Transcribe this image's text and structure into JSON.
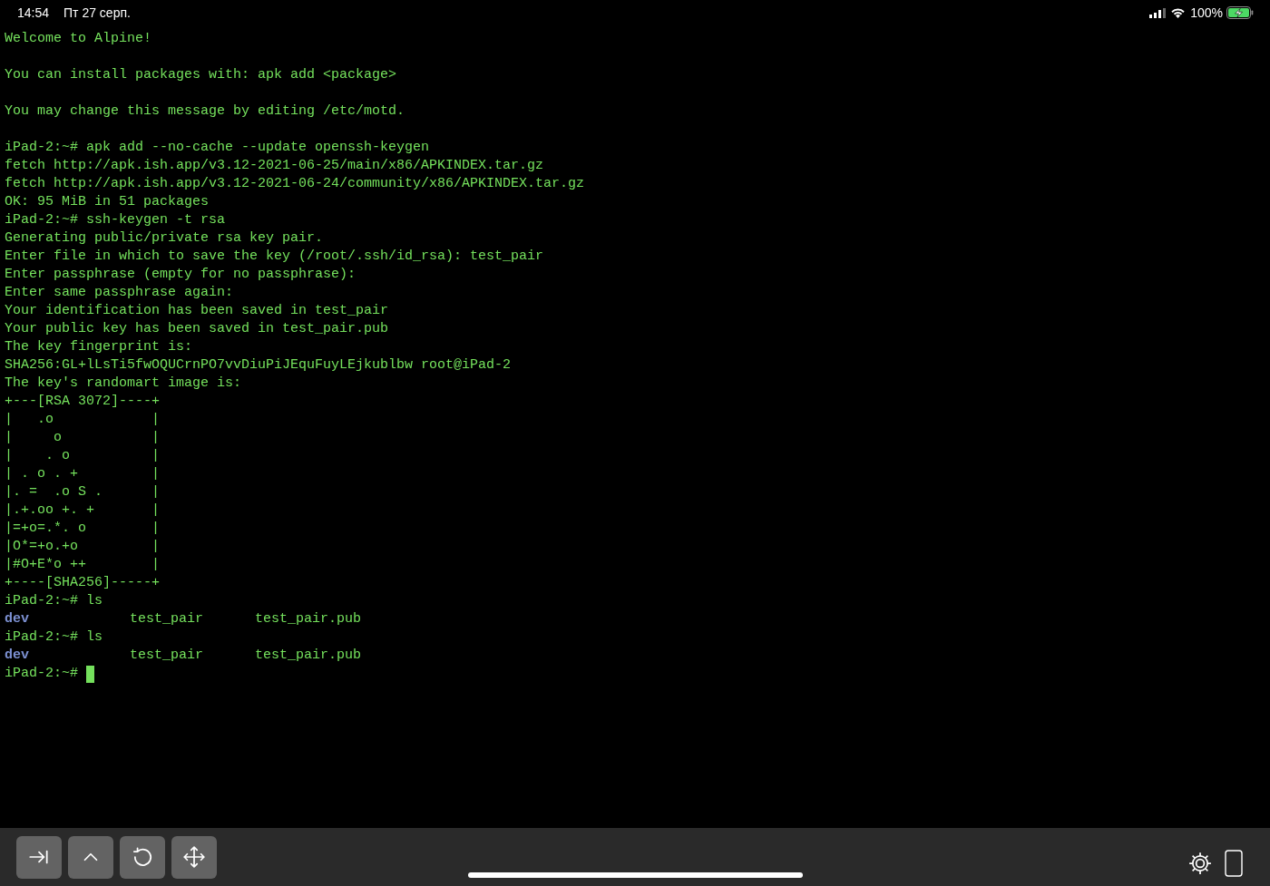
{
  "status_bar": {
    "time": "14:54",
    "date": "Пт 27 серп.",
    "battery": "100%",
    "charging": true
  },
  "terminal": {
    "lines": [
      {
        "kind": "text",
        "text": "Welcome to Alpine!"
      },
      {
        "kind": "blank"
      },
      {
        "kind": "text",
        "text": "You can install packages with: apk add <package>"
      },
      {
        "kind": "blank"
      },
      {
        "kind": "text",
        "text": "You may change this message by editing /etc/motd."
      },
      {
        "kind": "blank"
      },
      {
        "kind": "text",
        "text": "iPad-2:~# apk add --no-cache --update openssh-keygen"
      },
      {
        "kind": "text",
        "text": "fetch http://apk.ish.app/v3.12-2021-06-25/main/x86/APKINDEX.tar.gz"
      },
      {
        "kind": "text",
        "text": "fetch http://apk.ish.app/v3.12-2021-06-24/community/x86/APKINDEX.tar.gz"
      },
      {
        "kind": "text",
        "text": "OK: 95 MiB in 51 packages"
      },
      {
        "kind": "text",
        "text": "iPad-2:~# ssh-keygen -t rsa"
      },
      {
        "kind": "text",
        "text": "Generating public/private rsa key pair."
      },
      {
        "kind": "text",
        "text": "Enter file in which to save the key (/root/.ssh/id_rsa): test_pair"
      },
      {
        "kind": "text",
        "text": "Enter passphrase (empty for no passphrase):"
      },
      {
        "kind": "text",
        "text": "Enter same passphrase again:"
      },
      {
        "kind": "text",
        "text": "Your identification has been saved in test_pair"
      },
      {
        "kind": "text",
        "text": "Your public key has been saved in test_pair.pub"
      },
      {
        "kind": "text",
        "text": "The key fingerprint is:"
      },
      {
        "kind": "text",
        "text": "SHA256:GL+lLsTi5fwOQUCrnPO7vvDiuPiJEquFuyLEjkublbw root@iPad-2"
      },
      {
        "kind": "text",
        "text": "The key's randomart image is:"
      },
      {
        "kind": "text",
        "text": "+---[RSA 3072]----+"
      },
      {
        "kind": "text",
        "text": "|   .o            |"
      },
      {
        "kind": "text",
        "text": "|     o           |"
      },
      {
        "kind": "text",
        "text": "|    . o          |"
      },
      {
        "kind": "text",
        "text": "| . o . +         |"
      },
      {
        "kind": "text",
        "text": "|. =  .o S .      |"
      },
      {
        "kind": "text",
        "text": "|.+.oo +. +       |"
      },
      {
        "kind": "text",
        "text": "|=+o=.*. o        |"
      },
      {
        "kind": "text",
        "text": "|O*=+o.+o         |"
      },
      {
        "kind": "text",
        "text": "|#O+E*o ++        |"
      },
      {
        "kind": "text",
        "text": "+----[SHA256]-----+"
      },
      {
        "kind": "text",
        "text": "iPad-2:~# ls"
      },
      {
        "kind": "listing",
        "cells": [
          {
            "kind": "directory",
            "text": "dev"
          },
          {
            "kind": "file",
            "text": "test_pair"
          },
          {
            "kind": "file",
            "text": "test_pair.pub"
          }
        ]
      },
      {
        "kind": "text",
        "text": "iPad-2:~# ls"
      },
      {
        "kind": "listing",
        "cells": [
          {
            "kind": "directory",
            "text": "dev"
          },
          {
            "kind": "file",
            "text": "test_pair"
          },
          {
            "kind": "file",
            "text": "test_pair.pub"
          }
        ]
      },
      {
        "kind": "prompt",
        "text": "iPad-2:~#",
        "cursor": true
      }
    ]
  },
  "toolbar": {
    "buttons": [
      {
        "kind": "tab"
      },
      {
        "kind": "control"
      },
      {
        "kind": "escape"
      },
      {
        "kind": "arrows"
      }
    ]
  }
}
